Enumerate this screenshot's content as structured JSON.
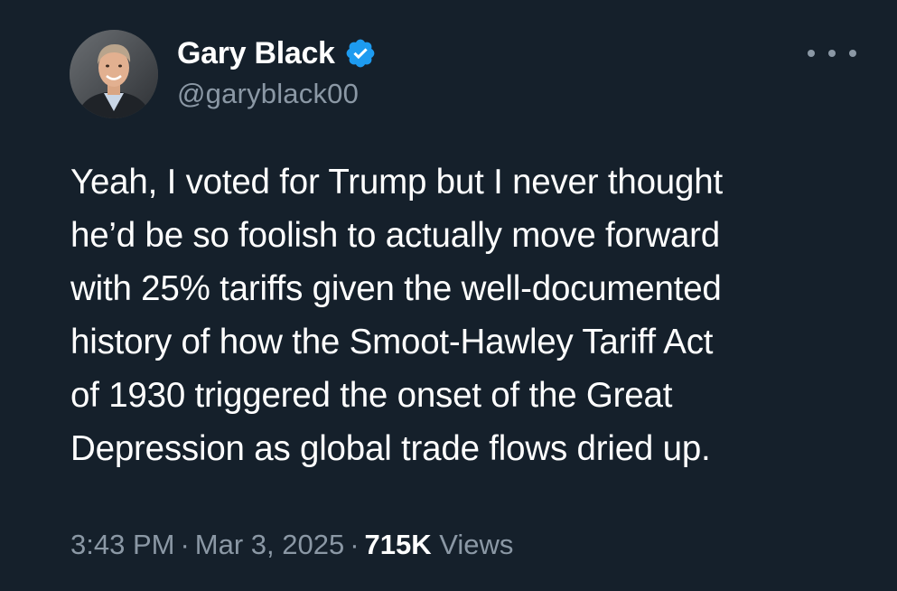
{
  "author": {
    "display_name": "Gary Black",
    "handle": "@garyblack00",
    "verified": true,
    "verified_color": "#1d9bf0",
    "avatar_icon": "profile-photo"
  },
  "tweet": {
    "text": "Yeah, I voted for Trump but I never thought\nhe’d be so foolish to actually move forward\nwith 25% tariffs given the well-documented\nhistory of how the Smoot-Hawley Tariff Act\nof 1930 triggered the onset of the Great\nDepression as global trade flows dried up."
  },
  "meta": {
    "time": "3:43 PM",
    "separator": "·",
    "date": "Mar 3, 2025",
    "views_count": "715K",
    "views_label": "Views"
  },
  "more_icon": "more-horizontal",
  "colors": {
    "background": "#15202b",
    "text_primary": "#ffffff",
    "text_secondary": "#8b98a5"
  }
}
